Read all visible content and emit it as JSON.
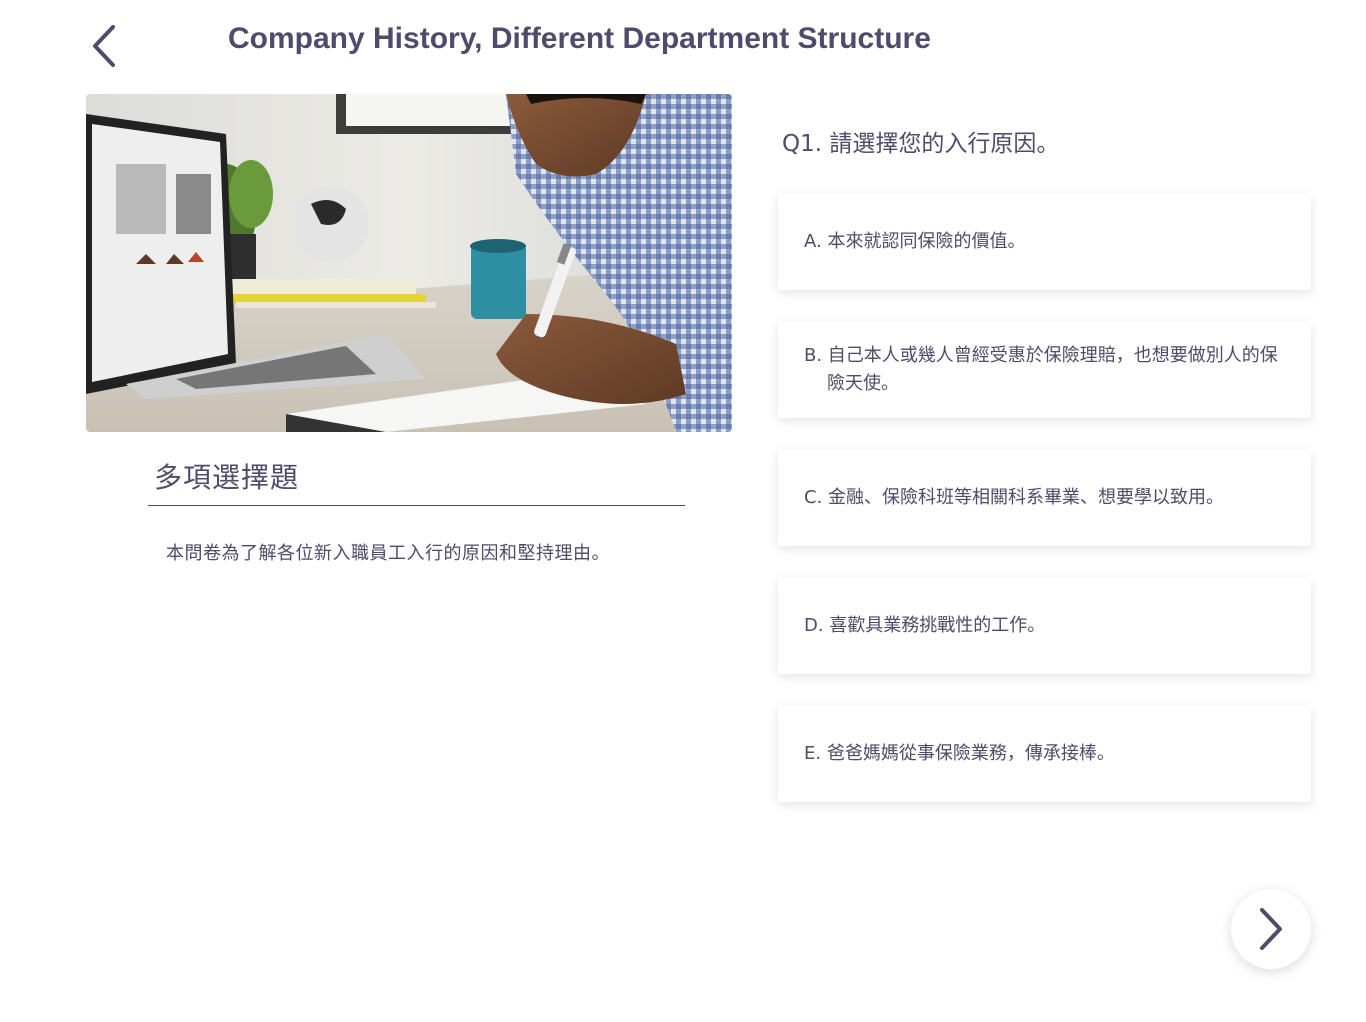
{
  "header": {
    "title": "Company History, Different Department Structure",
    "back_icon": "chevron-left-icon"
  },
  "left": {
    "image_alt": "photo of man writing in notebook beside laptop",
    "section_title": "多項選擇題",
    "description": "本問卷為了解各位新入職員工入行的原因和堅持理由。"
  },
  "question": {
    "text": "Q1. 請選擇您的入行原因。",
    "options": [
      {
        "label": "A. 本來就認同保險的價值。"
      },
      {
        "label": "B. 自己本人或幾人曾經受惠於保險理賠，也想要做別人的保險天使。"
      },
      {
        "label": "C. 金融、保險科班等相關科系畢業、想要學以致用。"
      },
      {
        "label": "D. 喜歡具業務挑戰性的工作。"
      },
      {
        "label": "E. 爸爸媽媽從事保險業務，傳承接棒。"
      }
    ]
  },
  "footer": {
    "next_icon": "chevron-right-icon"
  },
  "colors": {
    "primary": "#4f4b6b",
    "background": "#ffffff"
  }
}
